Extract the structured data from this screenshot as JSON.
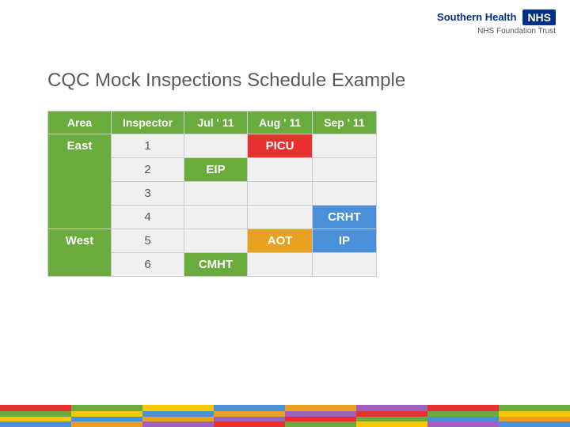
{
  "logo": {
    "org_name": "Southern Health",
    "nhs_text": "NHS",
    "trust_name": "NHS Foundation Trust"
  },
  "title": "CQC Mock Inspections Schedule Example",
  "table": {
    "headers": [
      "Area",
      "Inspector",
      "Jul ' 11",
      "Aug ' 11",
      "Sep ' 11"
    ],
    "rows": [
      {
        "area": "East",
        "inspector": "1",
        "jul": "",
        "aug": "PICU",
        "sep": "",
        "aug_class": "cell-red"
      },
      {
        "area": "",
        "inspector": "2",
        "jul": "EIP",
        "aug": "",
        "sep": "",
        "jul_class": "cell-green"
      },
      {
        "area": "",
        "inspector": "3",
        "jul": "",
        "aug": "",
        "sep": ""
      },
      {
        "area": "",
        "inspector": "4",
        "jul": "",
        "aug": "",
        "sep": "CRHT",
        "sep_class": "cell-blue"
      },
      {
        "area": "West",
        "inspector": "5",
        "jul": "",
        "aug": "AOT",
        "sep": "IP",
        "aug_class": "cell-orange",
        "sep_class": "cell-blue"
      },
      {
        "area": "",
        "inspector": "6",
        "jul": "CMHT",
        "aug": "",
        "sep": "",
        "jul_class": "cell-green"
      }
    ]
  },
  "bars": {
    "colors_row1": [
      "#e83030",
      "#6aab3e",
      "#f5c800",
      "#4a90d9",
      "#e8a020",
      "#a060c0",
      "#e83030",
      "#6aab3e"
    ],
    "colors_row2": [
      "#6aab3e",
      "#f5c800",
      "#4a90d9",
      "#e8a020",
      "#a060c0",
      "#e83030",
      "#6aab3e",
      "#f5c800"
    ],
    "colors_row3": [
      "#f5c800",
      "#4a90d9",
      "#e8a020",
      "#a060c0",
      "#e83030",
      "#6aab3e",
      "#4a90d9",
      "#e8a020"
    ],
    "colors_row4": [
      "#4a90d9",
      "#e8a020",
      "#a060c0",
      "#e83030",
      "#6aab3e",
      "#f5c800",
      "#a060c0",
      "#4a90d9"
    ]
  }
}
